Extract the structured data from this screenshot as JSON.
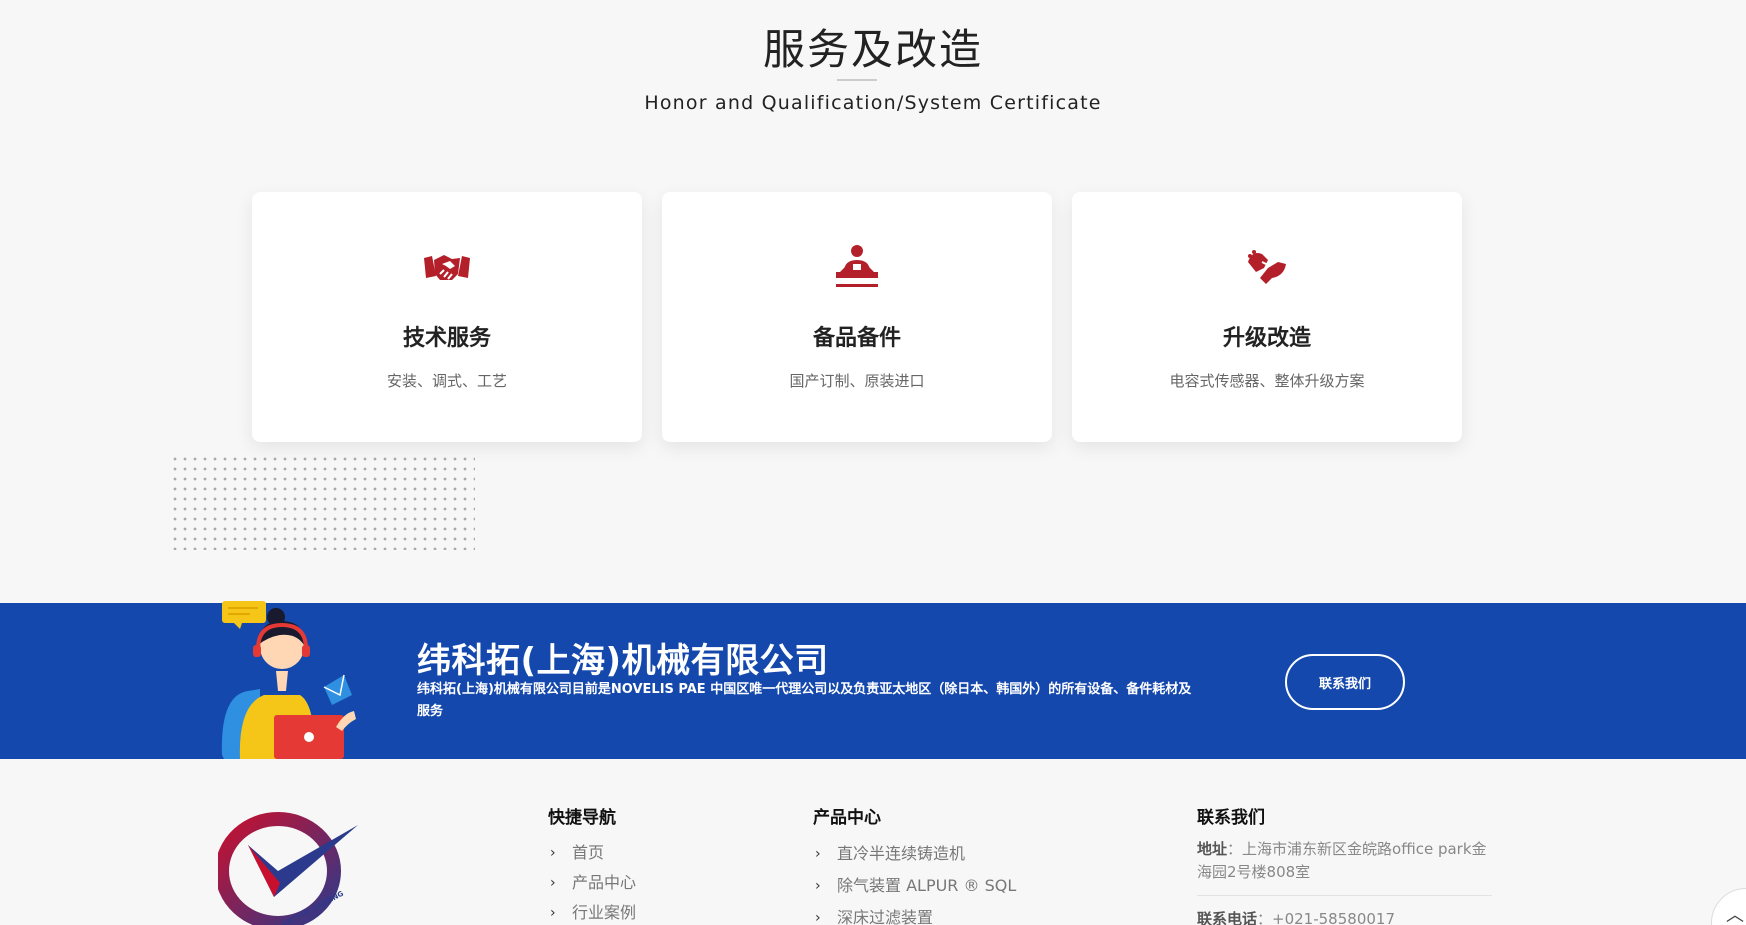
{
  "section": {
    "title": "服务及改造",
    "subtitle": "Honor and Qualification/System Certificate"
  },
  "cards": [
    {
      "icon": "handshake-icon",
      "title": "技术服务",
      "desc": "安装、调式、工艺"
    },
    {
      "icon": "technician-icon",
      "title": "备品备件",
      "desc": "国产订制、原装进口"
    },
    {
      "icon": "hands-icon",
      "title": "升级改造",
      "desc": "电容式传感器、整体升级方案"
    }
  ],
  "banner": {
    "title": "纬科拓(上海)机械有限公司",
    "desc": "纬科拓(上海)机械有限公司目前是NOVELIS PAE 中国区唯一代理公司以及负责亚太地区（除日本、韩国外）的所有设备、备件耗材及服务",
    "button": "联系我们"
  },
  "footer": {
    "logo_text": "VECTOR CASTING",
    "nav": {
      "title": "快捷导航",
      "items": [
        "首页",
        "产品中心",
        "行业案例"
      ]
    },
    "products": {
      "title": "产品中心",
      "items": [
        "直冷半连续铸造机",
        "除气装置 ALPUR ® SQL",
        "深床过滤装置"
      ]
    },
    "contact": {
      "title": "联系我们",
      "addr_label": "地址",
      "addr_value": "上海市浦东新区金皖路office park金海园2号楼808室",
      "phone_label": "联系电话",
      "phone_value": "+021-58580017"
    }
  },
  "colors": {
    "accent_red": "#b3202a",
    "banner_blue": "#1448ad"
  }
}
